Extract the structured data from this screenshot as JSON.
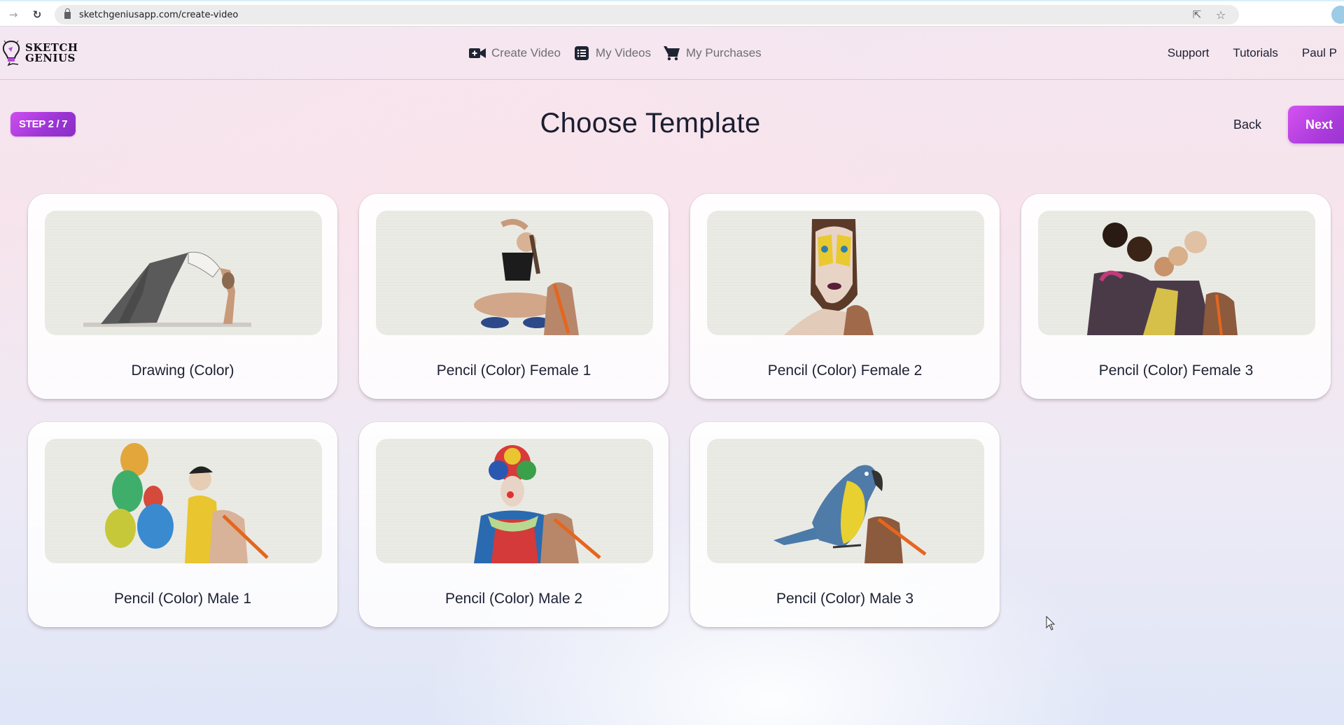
{
  "browser": {
    "url": "sketchgeniusapp.com/create-video",
    "icons": [
      "forward-icon",
      "reload-icon",
      "lock-icon",
      "share-icon",
      "star-icon",
      "profile-avatar"
    ]
  },
  "header": {
    "logo_line1": "SKETCH",
    "logo_line2": "GENIUS",
    "nav": [
      {
        "label": "Create Video",
        "icon": "video-camera-plus-icon"
      },
      {
        "label": "My Videos",
        "icon": "list-icon"
      },
      {
        "label": "My Purchases",
        "icon": "shopping-cart-icon"
      }
    ],
    "right_nav": [
      {
        "label": "Support"
      },
      {
        "label": "Tutorials"
      },
      {
        "label": "Paul P"
      }
    ]
  },
  "wizard": {
    "step_label": "STEP 2 / 7",
    "current_step": 2,
    "total_steps": 7,
    "title": "Choose Template",
    "back_label": "Back",
    "next_label": "Next",
    "accent_color": "#b03fe0"
  },
  "templates": [
    {
      "label": "Drawing (Color)",
      "thumbnail": "woman doing yoga backbend pose sketch"
    },
    {
      "label": "Pencil (Color) Female 1",
      "thumbnail": "woman stretching seated with hand holding pencil"
    },
    {
      "label": "Pencil (Color) Female 2",
      "thumbnail": "woman face with colorful butterfly makeup with hand holding pencil"
    },
    {
      "label": "Pencil (Color) Female 3",
      "thumbnail": "group of friends with color powder with hand holding pencil"
    },
    {
      "label": "Pencil (Color) Male 1",
      "thumbnail": "boy with colorful balloons with hand holding pencil"
    },
    {
      "label": "Pencil (Color) Male 2",
      "thumbnail": "clown with rainbow wig with hand holding pencil"
    },
    {
      "label": "Pencil (Color) Male 3",
      "thumbnail": "blue and yellow macaw parrot with hand holding pencil"
    }
  ]
}
